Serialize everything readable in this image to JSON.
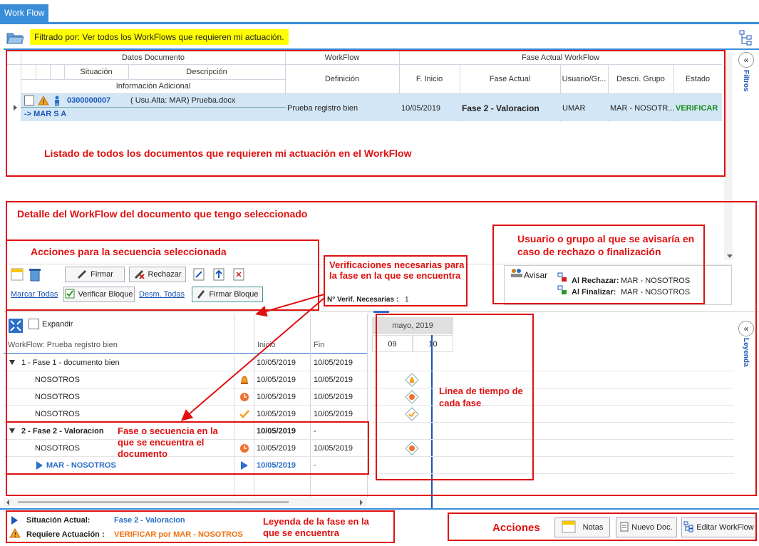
{
  "app": {
    "tab": "Work Flow"
  },
  "filter": {
    "text": "Filtrado por: Ver todos los WorkFlows que requieren mi actuación."
  },
  "grid": {
    "group_headers": [
      "Datos Documento",
      "WorkFlow",
      "Fase Actual WorkFlow"
    ],
    "col_situacion": "Situación",
    "col_descripcion": "Descripción",
    "col_info": "Información Adicional",
    "col_definicion": "Definición",
    "col_finicio": "F. Inicio",
    "col_fase": "Fase Actual",
    "col_usuario": "Usuario/Gr...",
    "col_descri": "Descri. Grupo",
    "col_estado": "Estado",
    "row": {
      "number": "0300000007",
      "description": "( Usu.Alta: MAR) Prueba.docx",
      "info": "-> MAR S A",
      "definition": "Prueba registro bien",
      "start": "10/05/2019",
      "phase": "Fase 2 - Valoracion",
      "user": "UMAR",
      "group": "MAR - NOSOTR...",
      "status": "VERIFICAR"
    }
  },
  "side": {
    "filters": "Filtros",
    "legend": "Leyenda"
  },
  "actions": {
    "firmar": "Firmar",
    "rechazar": "Rechazar",
    "marcar_todas": "Marcar Todas",
    "verificar_bloque": "Verificar Bloque",
    "desm_todas": "Desm. Todas",
    "firmar_bloque": "Firmar Bloque"
  },
  "verif": {
    "label": "N° Verif. Necesarias :",
    "value": "1"
  },
  "avisar": {
    "label": "Avisar",
    "rechazar_label": "Al Rechazar:",
    "rechazar_value": "MAR - NOSOTROS",
    "finalizar_label": "Al Finalizar:",
    "finalizar_value": "MAR - NOSOTROS"
  },
  "tree": {
    "expand": "Expandir",
    "title": "WorkFlow: Prueba registro bien",
    "col_inicio": "Inicio",
    "col_fin": "Fin",
    "rows": [
      {
        "label": "1 - Fase 1 - documento bien",
        "inicio": "10/05/2019",
        "fin": "10/05/2019"
      },
      {
        "label": "NOSOTROS",
        "inicio": "10/05/2019",
        "fin": "10/05/2019"
      },
      {
        "label": "NOSOTROS",
        "inicio": "10/05/2019",
        "fin": "10/05/2019"
      },
      {
        "label": "NOSOTROS",
        "inicio": "10/05/2019",
        "fin": "10/05/2019"
      },
      {
        "label": "2 - Fase 2 - Valoracion",
        "inicio": "10/05/2019",
        "fin": "-"
      },
      {
        "label": "NOSOTROS",
        "inicio": "10/05/2019",
        "fin": "10/05/2019"
      },
      {
        "label": "MAR - NOSOTROS",
        "inicio": "10/05/2019",
        "fin": "-"
      }
    ]
  },
  "gantt": {
    "month": "mayo, 2019",
    "day1": "09",
    "day2": "10"
  },
  "status": {
    "situacion_label": "Situación Actual:",
    "situacion_value": "Fase 2 - Valoracion",
    "requiere_label": "Requiere Actuación :",
    "requiere_value": "VERIFICAR por MAR - NOSOTROS"
  },
  "bottom": {
    "notas": "Notas",
    "nuevo": "Nuevo Doc.",
    "editar": "Editar WorkFlow"
  },
  "annotations": {
    "a1": "Listado de todos los documentos que requieren mi actuación en el WorkFlow",
    "a2": "Detalle del WorkFlow del documento que tengo seleccionado",
    "a3": "Acciones para la secuencia seleccionada",
    "a4": "Verificaciones necesarias para la fase en la que se encuentra",
    "a5": "Usuario o grupo al que se avisaría en caso de rechazo o finalización",
    "a6": "Linea de tiempo de cada fase",
    "a7": "Fase o secuencia en la que se encuentra el documento",
    "a8": "Leyenda de la fase en la que se encuentra",
    "a9": "Acciones"
  },
  "colors": {
    "accent": "#3a8ed8",
    "annotation": "#e01010",
    "highlight": "#ffff00",
    "status_green": "#1a8a1a"
  }
}
